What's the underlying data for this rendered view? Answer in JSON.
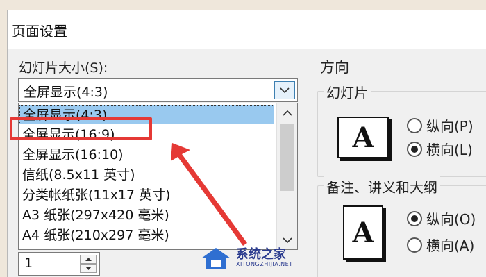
{
  "dialog": {
    "title": "页面设置"
  },
  "slide_size": {
    "label": "幻灯片大小(S):",
    "selected_value": "全屏显示(4:3)",
    "options": [
      "全屏显示(4:3)",
      "全屏显示(16:9)",
      "全屏显示(16:10)",
      "信纸(8.5x11 英寸)",
      "分类帐纸张(11x17 英寸)",
      "A3 纸张(297x420 毫米)",
      "A4 纸张(210x297 毫米)"
    ],
    "highlighted_index": 0
  },
  "number_field": {
    "value": "1"
  },
  "orientation": {
    "title": "方向",
    "slides": {
      "caption": "幻灯片",
      "portrait_label": "纵向(P)",
      "landscape_label": "横向(L)",
      "selected": "landscape"
    },
    "notes": {
      "caption": "备注、讲义和大纲",
      "portrait_label": "纵向(O)",
      "landscape_label": "横向(A)",
      "selected": "portrait"
    },
    "icon_letter": "A"
  },
  "annotation": {
    "color": "#e53935",
    "highlighted_option_index": 1
  },
  "watermark": {
    "text": "系统之家",
    "sub": "XITONGZHIJIA.NET"
  }
}
